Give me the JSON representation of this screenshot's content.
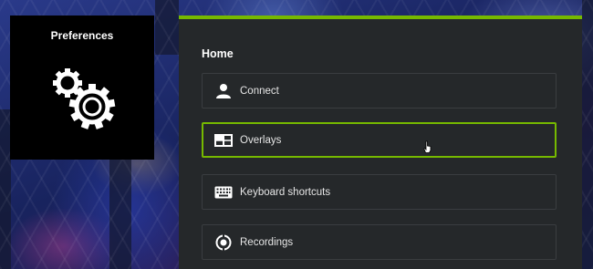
{
  "preferences": {
    "title": "Preferences",
    "icon": "gears-icon"
  },
  "panel": {
    "title": "Home",
    "accent_color": "#76b900",
    "items": [
      {
        "label": "Connect",
        "icon": "user-icon",
        "selected": false
      },
      {
        "label": "Overlays",
        "icon": "overlay-layout-icon",
        "selected": true
      },
      {
        "label": "Keyboard shortcuts",
        "icon": "keyboard-icon",
        "selected": false
      },
      {
        "label": "Recordings",
        "icon": "recordings-icon",
        "selected": false
      }
    ]
  }
}
